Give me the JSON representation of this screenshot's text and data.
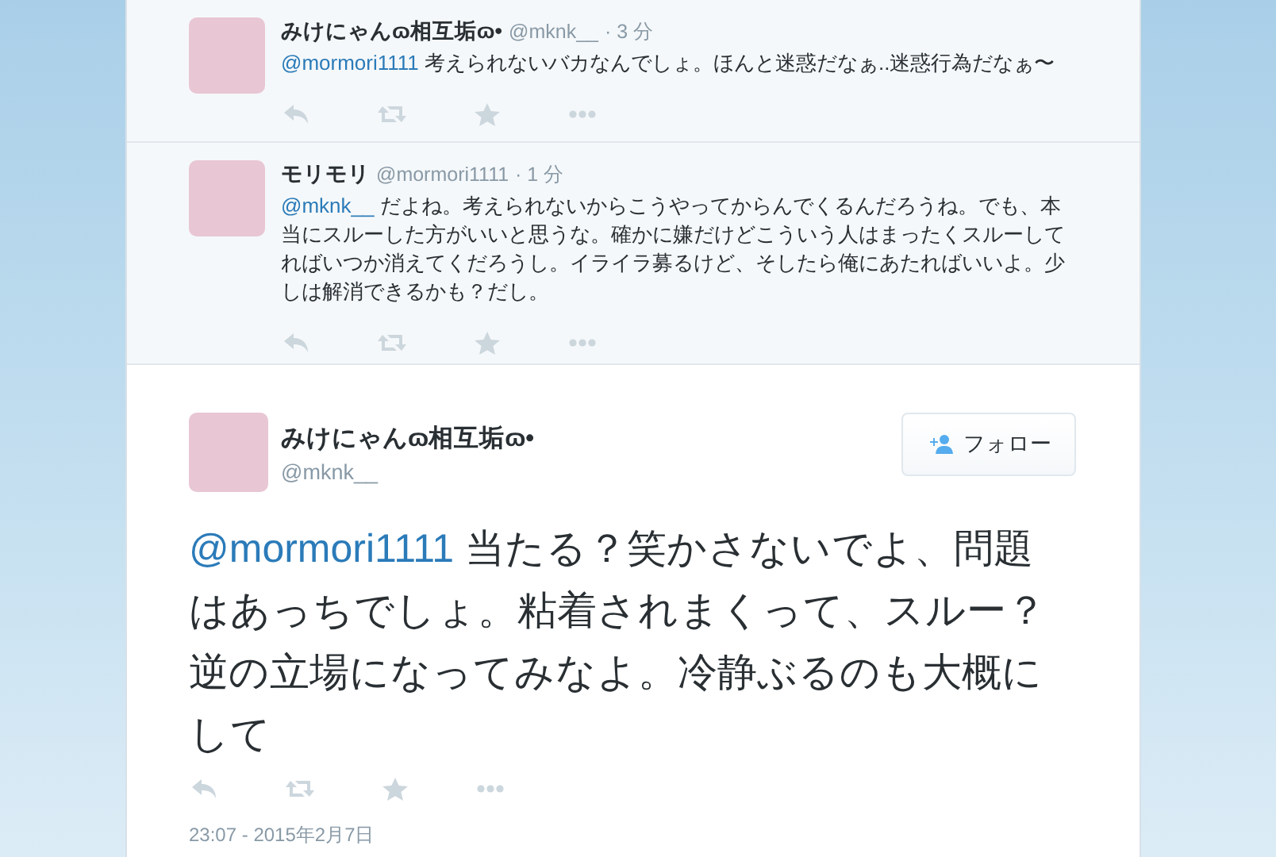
{
  "replies": [
    {
      "name": "みけにゃんɷ相互垢ɷ•",
      "handle": "@mknk__",
      "time": "· 3 分",
      "mention": "@mormori1111",
      "text": " 考えられないバカなんでしょ。ほんと迷惑だなぁ..迷惑行為だなぁ〜"
    },
    {
      "name": "モリモリ",
      "handle": "@mormori1111",
      "time": "· 1 分",
      "mention": "@mknk__",
      "text": " だよね。考えられないからこうやってからんでくるんだろうね。でも、本当にスルーした方がいいと思うな。確かに嫌だけどこういう人はまったくスルーしてればいつか消えてくだろうし。イライラ募るけど、そしたら俺にあたればいいよ。少しは解消できるかも？だし。"
    }
  ],
  "main": {
    "name": "みけにゃんɷ相互垢ɷ•",
    "handle": "@mknk__",
    "follow": "フォロー",
    "mention": "@mormori1111",
    "text": " 当たる？笑かさないでよ、問題はあっちでしょ。粘着されまくって、スルー？逆の立場になってみなよ。冷静ぶるのも大概にして",
    "date": "23:07 - 2015年2月7日"
  }
}
